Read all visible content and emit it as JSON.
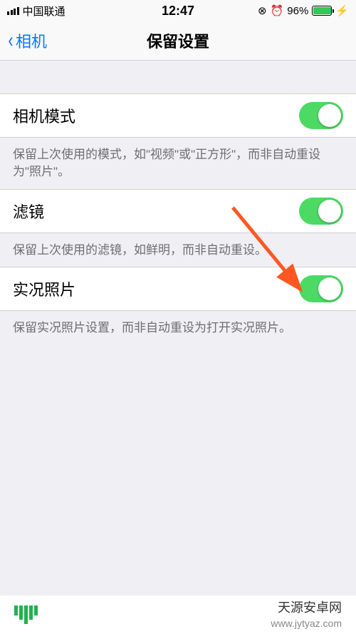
{
  "statusBar": {
    "carrier": "中国联通",
    "time": "12:47",
    "batteryPct": "96%"
  },
  "nav": {
    "back": "相机",
    "title": "保留设置"
  },
  "rows": {
    "cameraMode": {
      "label": "相机模式",
      "on": true
    },
    "filter": {
      "label": "滤镜",
      "on": true
    },
    "livePhoto": {
      "label": "实况照片",
      "on": true
    }
  },
  "footers": {
    "cameraMode": "保留上次使用的模式，如\"视频\"或\"正方形\"，而非自动重设为\"照片\"。",
    "filter": "保留上次使用的滤镜，如鲜明，而非自动重设。",
    "livePhoto": "保留实况照片设置，而非自动重设为打开实况照片。"
  },
  "watermark": {
    "brand": "天源安卓网",
    "url": "www.jytyaz.com"
  }
}
